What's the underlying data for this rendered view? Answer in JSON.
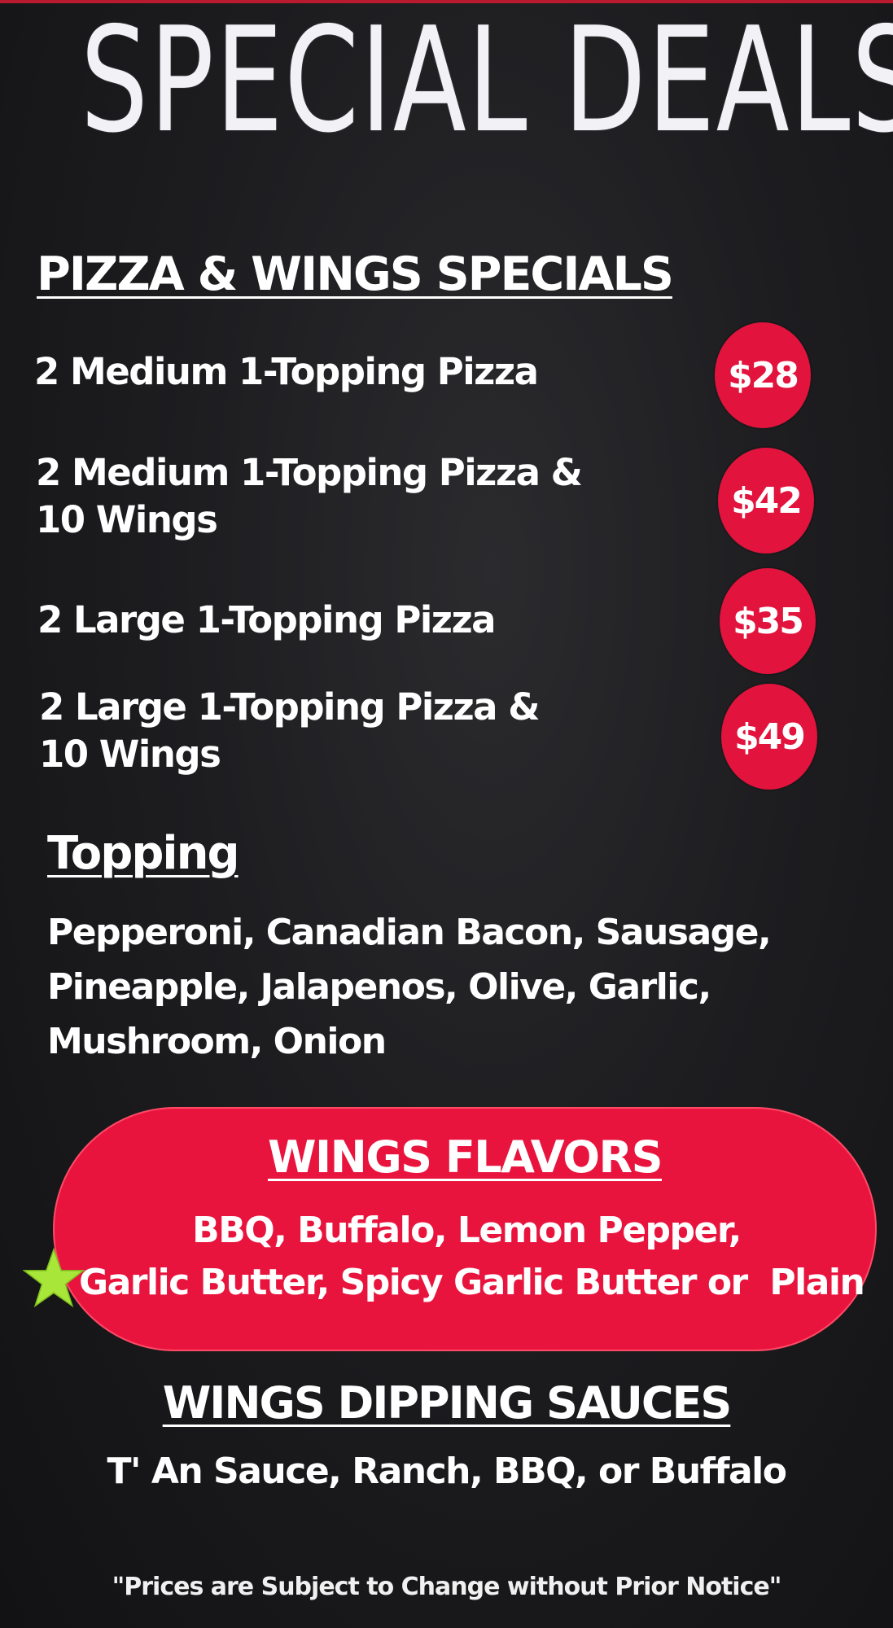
{
  "title": "SPECIAL DEALS",
  "pizza_wings": {
    "heading": "PIZZA & WINGS SPECIALS",
    "deals": [
      {
        "line1": "2 Medium 1-Topping Pizza",
        "line2": "",
        "price": "$28"
      },
      {
        "line1": "2 Medium 1-Topping Pizza &",
        "line2": "10 Wings",
        "price": "$42"
      },
      {
        "line1": "2 Large 1-Topping Pizza",
        "line2": "",
        "price": "$35"
      },
      {
        "line1": "2 Large 1-Topping Pizza &",
        "line2": "10 Wings",
        "price": "$49"
      }
    ]
  },
  "topping": {
    "heading": "Topping",
    "lines": [
      "Pepperoni, Canadian Bacon, Sausage,",
      "Pineapple, Jalapenos, Olive, Garlic,",
      "Mushroom, Onion"
    ]
  },
  "wings_flavors": {
    "heading": "WINGS FLAVORS",
    "lines": [
      "BBQ, Buffalo, Lemon Pepper,",
      "Garlic Butter, Spicy Garlic Butter or  Plain"
    ],
    "icon": "star-icon"
  },
  "dipping_sauces": {
    "heading": "WINGS DIPPING SAUCES",
    "text": "T' An Sauce, Ranch, BBQ, or Buffalo"
  },
  "notice": "\"Prices are Subject to Change without Prior Notice\"",
  "colors": {
    "accent_red": "#e8143e",
    "star_green": "#a8e63a",
    "background": "#1d1d20"
  }
}
